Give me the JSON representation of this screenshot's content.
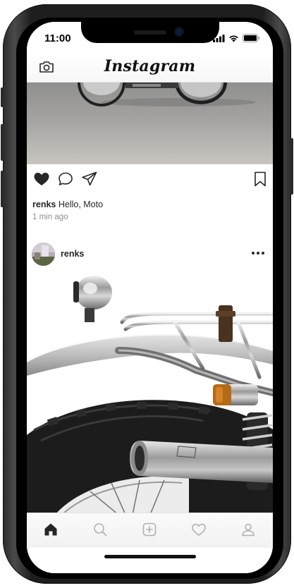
{
  "status_bar": {
    "time": "11:00"
  },
  "header": {
    "logo": "Instagram"
  },
  "post_1": {
    "username": "renks",
    "caption": "Hello, Moto",
    "timestamp": "1 min ago",
    "liked": true
  },
  "post_2": {
    "username": "renks"
  },
  "tab_bar": {
    "active": "home"
  },
  "colors": {
    "accent": "#262626",
    "muted": "#8e8e8e",
    "tab_inactive": "#b0b0b0"
  }
}
